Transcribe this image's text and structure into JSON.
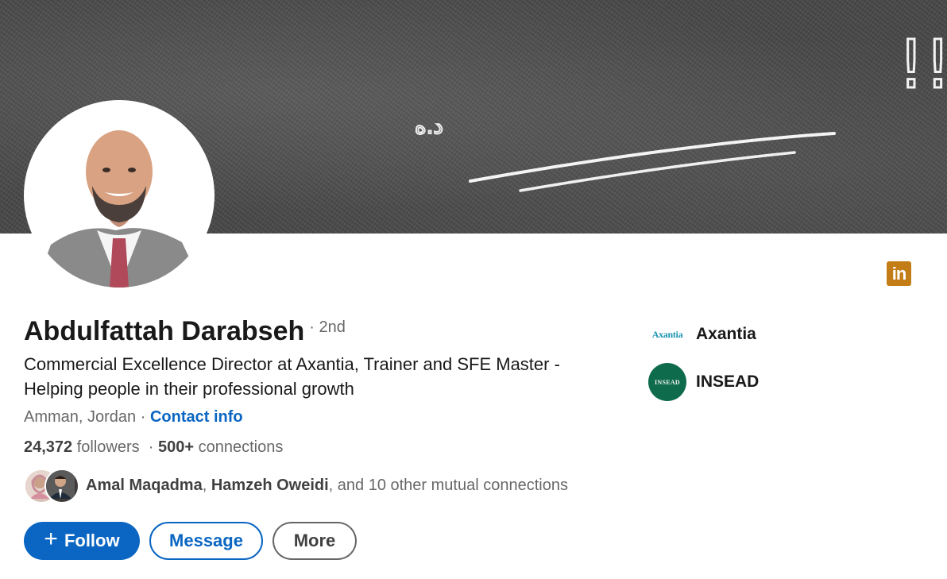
{
  "banner": {
    "chalk_text": "قوموا إشتغلوا !!",
    "chalk_signature": "د.ه"
  },
  "profile": {
    "name": "Abdulfattah Darabseh",
    "degree": "· 2nd",
    "headline": "Commercial Excellence Director at Axantia, Trainer and SFE Master - Helping people in their professional growth",
    "location": "Amman, Jordan",
    "separator": " · ",
    "contact_label": "Contact info",
    "followers_count": "24,372",
    "followers_label": "followers",
    "connections_count": "500+",
    "connections_label": "connections",
    "mutual": {
      "first": "Amal Maqadma",
      "second": "Hamzeh Oweidi",
      "rest": ", and 10 other mutual connections"
    }
  },
  "actions": {
    "follow_plus": "+",
    "follow_label": "Follow",
    "message_label": "Message",
    "more_label": "More"
  },
  "organizations": [
    {
      "name": "Axantia",
      "logo_text": "Axantia"
    },
    {
      "name": "INSEAD",
      "logo_text": "INSEAD"
    }
  ],
  "badge": {
    "icon": "linkedin-icon",
    "text": "in"
  },
  "colors": {
    "accent": "#0a66c2",
    "badge": "#c37d16",
    "insead": "#0e6b4b",
    "banner": "#4b4b4b"
  }
}
